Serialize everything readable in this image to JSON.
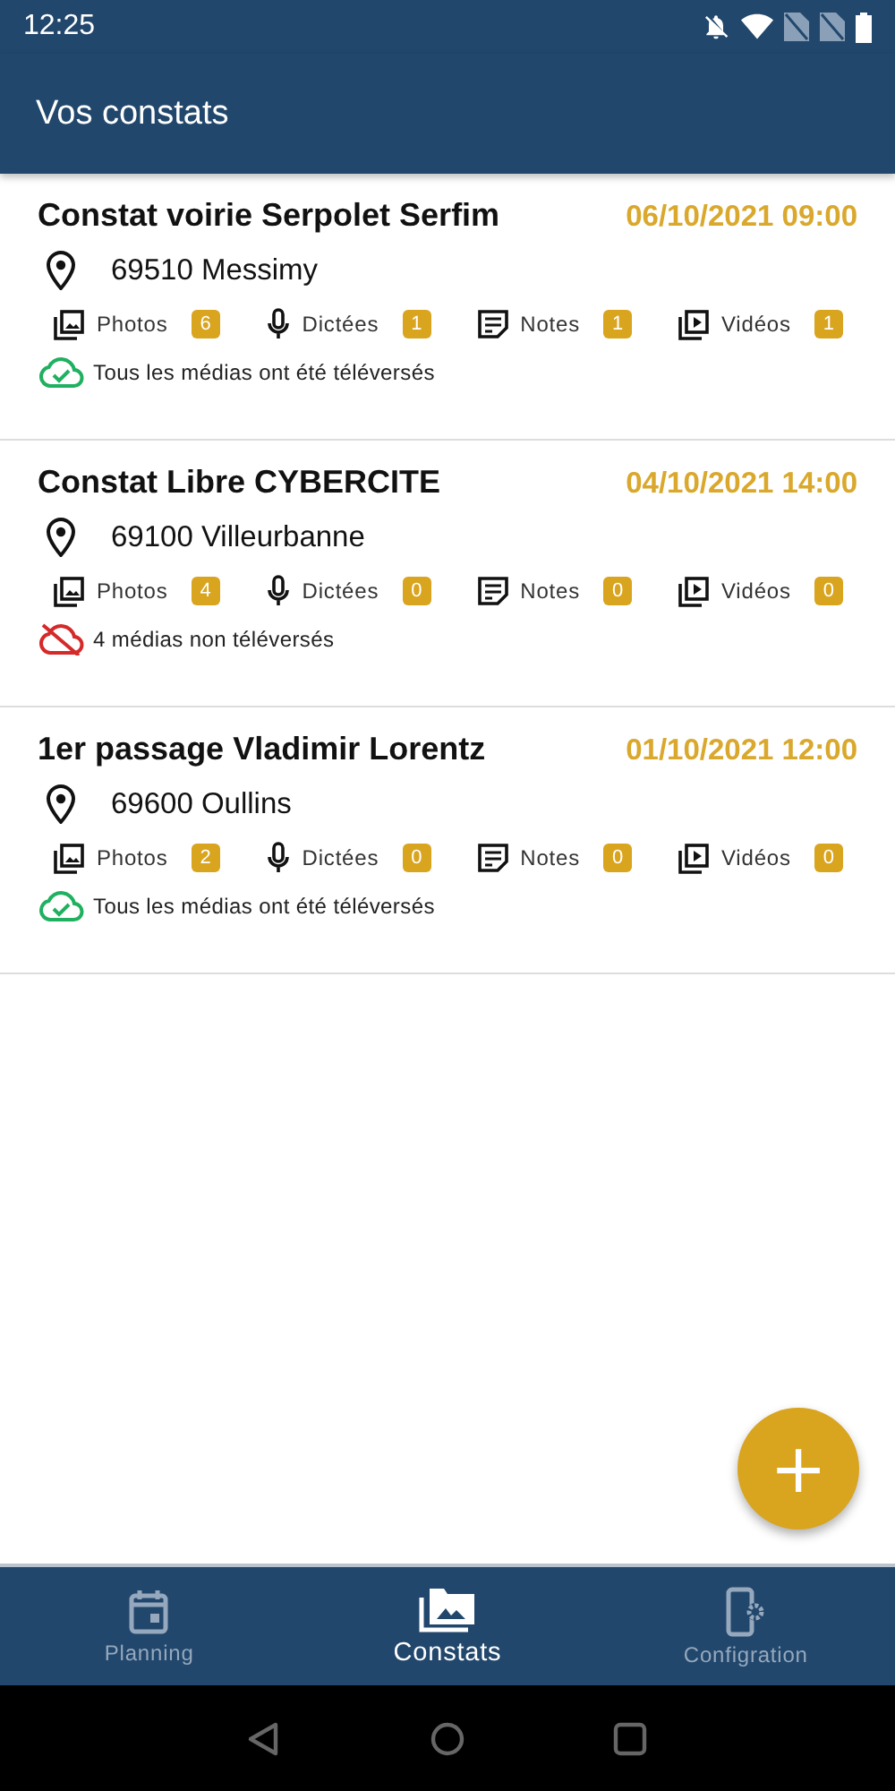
{
  "status_bar": {
    "time": "12:25"
  },
  "app_bar": {
    "title": "Vos constats"
  },
  "constats": [
    {
      "title": "Constat voirie Serpolet Serfim",
      "date": "06/10/2021 09:00",
      "address": "69510 Messimy",
      "media": [
        {
          "kind": "photos",
          "label": "Photos",
          "count": "6"
        },
        {
          "kind": "dictees",
          "label": "Dictées",
          "count": "1"
        },
        {
          "kind": "notes",
          "label": "Notes",
          "count": "1"
        },
        {
          "kind": "videos",
          "label": "Vidéos",
          "count": "1"
        }
      ],
      "uploaded": true,
      "upload_status": "Tous les médias ont été téléversés"
    },
    {
      "title": "Constat Libre CYBERCITE",
      "date": "04/10/2021 14:00",
      "address": "69100 Villeurbanne",
      "media": [
        {
          "kind": "photos",
          "label": "Photos",
          "count": "4"
        },
        {
          "kind": "dictees",
          "label": "Dictées",
          "count": "0"
        },
        {
          "kind": "notes",
          "label": "Notes",
          "count": "0"
        },
        {
          "kind": "videos",
          "label": "Vidéos",
          "count": "0"
        }
      ],
      "uploaded": false,
      "upload_status": "4 médias non téléversés"
    },
    {
      "title": "1er passage Vladimir Lorentz",
      "date": "01/10/2021 12:00",
      "address": "69600 Oullins",
      "media": [
        {
          "kind": "photos",
          "label": "Photos",
          "count": "2"
        },
        {
          "kind": "dictees",
          "label": "Dictées",
          "count": "0"
        },
        {
          "kind": "notes",
          "label": "Notes",
          "count": "0"
        },
        {
          "kind": "videos",
          "label": "Vidéos",
          "count": "0"
        }
      ],
      "uploaded": true,
      "upload_status": "Tous les médias ont été téléversés"
    }
  ],
  "fab": {
    "symbol": "+"
  },
  "bottom_nav": [
    {
      "kind": "planning",
      "label": "Planning",
      "selected": false
    },
    {
      "kind": "constats",
      "label": "Constats",
      "selected": true
    },
    {
      "kind": "configuration",
      "label": "Configration",
      "selected": false
    }
  ]
}
